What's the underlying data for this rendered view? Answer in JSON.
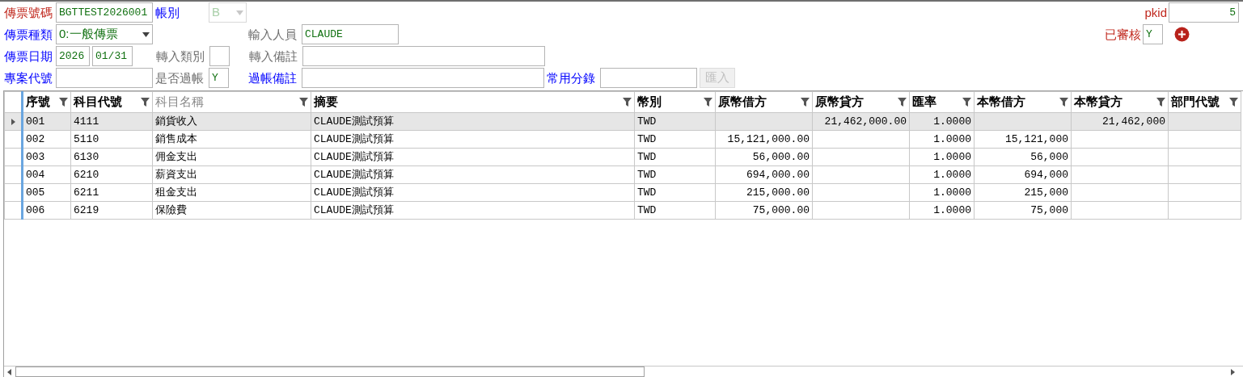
{
  "form": {
    "voucher_no": {
      "label": "傳票號碼",
      "kind": "required",
      "value": "BGTTEST2026001"
    },
    "book": {
      "label": "帳別",
      "kind": "link",
      "value": "B",
      "disabled": true
    },
    "pkid": {
      "label": "pkid",
      "kind": "required",
      "value": "5"
    },
    "voucher_type": {
      "label": "傳票種類",
      "kind": "link",
      "value": "0:一般傳票",
      "disabled": false
    },
    "entered_by": {
      "label": "輸入人員",
      "kind": "plain",
      "value": "CLAUDE"
    },
    "reviewed": {
      "label": "已審核",
      "kind": "required",
      "value": "Y"
    },
    "voucher_date": {
      "label": "傳票日期",
      "kind": "link",
      "year": "2026",
      "day": "01/31"
    },
    "import_type": {
      "label": "轉入類別",
      "kind": "plain"
    },
    "import_note": {
      "label": "轉入備註",
      "kind": "plain"
    },
    "project_code": {
      "label": "專案代號",
      "kind": "link"
    },
    "posted": {
      "label": "是否過帳",
      "kind": "plain",
      "value": "Y"
    },
    "posting_note": {
      "label": "過帳備註",
      "kind": "link"
    },
    "common_entry": {
      "label": "常用分錄",
      "kind": "link"
    },
    "import_button": {
      "label": "匯入",
      "disabled": true
    }
  },
  "table": {
    "columns": [
      {
        "label": "序號",
        "kind": "text",
        "readonly": false
      },
      {
        "label": "科目代號",
        "kind": "text",
        "readonly": false
      },
      {
        "label": "科目名稱",
        "kind": "text",
        "readonly": true
      },
      {
        "label": "摘要",
        "kind": "text",
        "readonly": false
      },
      {
        "label": "幣別",
        "kind": "text",
        "readonly": false
      },
      {
        "label": "原幣借方",
        "kind": "number",
        "readonly": false
      },
      {
        "label": "原幣貸方",
        "kind": "number",
        "readonly": false
      },
      {
        "label": "匯率",
        "kind": "number",
        "readonly": false
      },
      {
        "label": "本幣借方",
        "kind": "number",
        "readonly": false
      },
      {
        "label": "本幣貸方",
        "kind": "number",
        "readonly": false
      },
      {
        "label": "部門代號",
        "kind": "text",
        "readonly": false
      }
    ],
    "rows": [
      {
        "selected": true,
        "cells": [
          "001",
          "4111",
          "銷貨收入",
          "CLAUDE測試預算",
          "TWD",
          "",
          "21,462,000.00",
          "1.0000",
          "",
          "21,462,000",
          ""
        ]
      },
      {
        "selected": false,
        "cells": [
          "002",
          "5110",
          "銷售成本",
          "CLAUDE測試預算",
          "TWD",
          "15,121,000.00",
          "",
          "1.0000",
          "15,121,000",
          "",
          ""
        ]
      },
      {
        "selected": false,
        "cells": [
          "003",
          "6130",
          "佣金支出",
          "CLAUDE測試預算",
          "TWD",
          "56,000.00",
          "",
          "1.0000",
          "56,000",
          "",
          ""
        ]
      },
      {
        "selected": false,
        "cells": [
          "004",
          "6210",
          "薪資支出",
          "CLAUDE測試預算",
          "TWD",
          "694,000.00",
          "",
          "1.0000",
          "694,000",
          "",
          ""
        ]
      },
      {
        "selected": false,
        "cells": [
          "005",
          "6211",
          "租金支出",
          "CLAUDE測試預算",
          "TWD",
          "215,000.00",
          "",
          "1.0000",
          "215,000",
          "",
          ""
        ]
      },
      {
        "selected": false,
        "cells": [
          "006",
          "6219",
          "保險費",
          "CLAUDE測試預算",
          "TWD",
          "75,000.00",
          "",
          "1.0000",
          "75,000",
          "",
          ""
        ]
      }
    ]
  }
}
